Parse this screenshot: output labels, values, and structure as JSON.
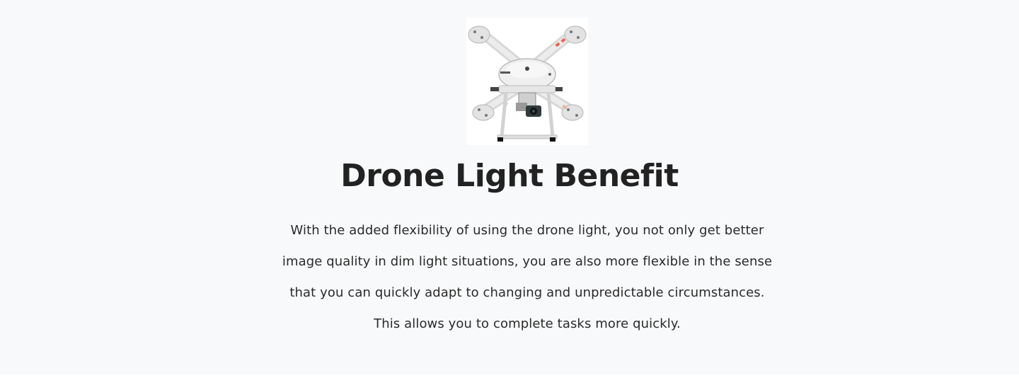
{
  "hero": {
    "image_icon": "drone-icon",
    "title": "Drone Light Benefit",
    "paragraph_lines": [
      "With the added flexibility of using the drone light, you not only get better",
      "image quality in dim light situations, you are also more flexible in the sense",
      "that you can quickly adapt to changing and unpredictable circumstances.",
      "This allows you to complete tasks more quickly."
    ]
  },
  "colors": {
    "section_background": "#f8f9fb",
    "page_background": "#ffffff",
    "heading_text": "#222222",
    "body_text": "#2a2a2a"
  }
}
